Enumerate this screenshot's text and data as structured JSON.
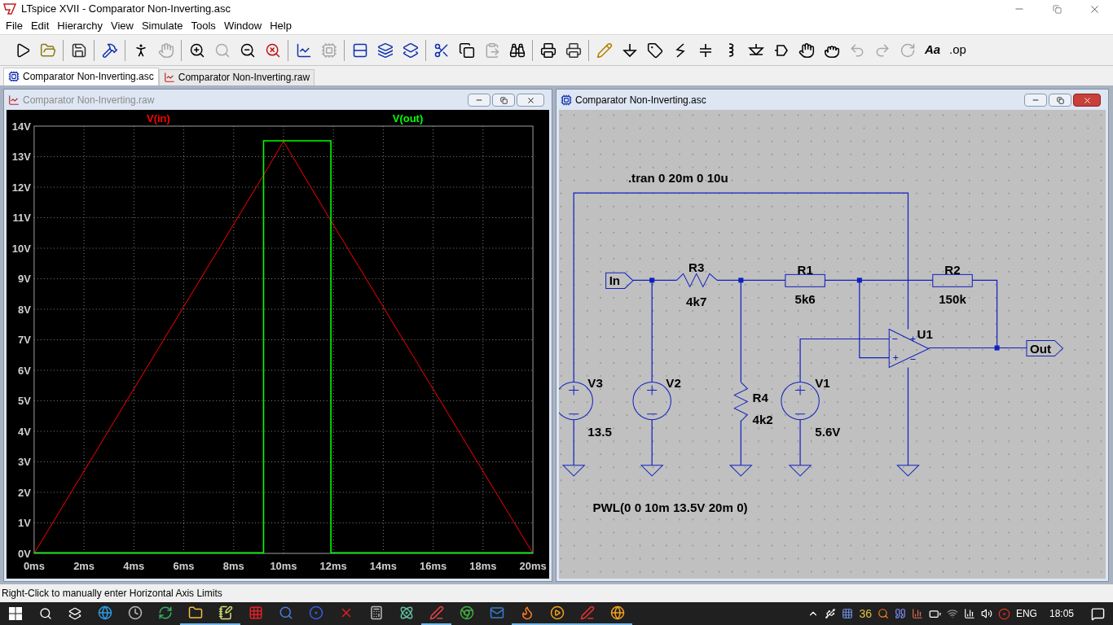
{
  "app": {
    "title": "LTspice XVII - Comparator Non-Inverting.asc"
  },
  "menu": [
    "File",
    "Edit",
    "Hierarchy",
    "View",
    "Simulate",
    "Tools",
    "Window",
    "Help"
  ],
  "toolbar": [
    {
      "disabled": false
    },
    {
      "disabled": false
    },
    {
      "disabled": false
    },
    {
      "disabled": false
    },
    {
      "disabled": false
    },
    {
      "disabled": true
    },
    {
      "disabled": false
    },
    {
      "disabled": true
    },
    {
      "disabled": false
    },
    {
      "disabled": false
    },
    {
      "disabled": false
    },
    {
      "disabled": true
    },
    {
      "disabled": false
    },
    {
      "disabled": false
    },
    {
      "disabled": false
    },
    {
      "disabled": false
    },
    {
      "disabled": false
    },
    {
      "disabled": true
    },
    {
      "disabled": false
    },
    {
      "disabled": false
    },
    {
      "disabled": false
    },
    {
      "disabled": false
    },
    {
      "disabled": false
    },
    {
      "disabled": false
    },
    {
      "disabled": false
    },
    {
      "disabled": false
    },
    {
      "disabled": false
    },
    {
      "disabled": false
    },
    {
      "disabled": false
    },
    {
      "disabled": false
    },
    {
      "disabled": false
    },
    {
      "disabled": true
    },
    {
      "disabled": true
    },
    {
      "disabled": true
    },
    {
      "disabled": false,
      "label": "Aa"
    },
    {
      "disabled": false,
      "label": ".op"
    }
  ],
  "tabs": [
    {
      "label": "Comparator Non-Inverting.asc",
      "kind": "schematic",
      "selected": true
    },
    {
      "label": "Comparator Non-Inverting.raw",
      "kind": "waveform",
      "selected": false
    }
  ],
  "waveform_window": {
    "title": "Comparator Non-Inverting.raw",
    "active": false,
    "chart_data": {
      "type": "line",
      "x": [
        0,
        9.2,
        9.2,
        10,
        11.9,
        11.9,
        20
      ],
      "series": [
        {
          "name": "V(in)",
          "color": "#ff0000",
          "values": [
            0,
            12.4,
            12.4,
            13.5,
            10.9,
            10.9,
            0
          ]
        },
        {
          "name": "V(out)",
          "color": "#00ff00",
          "values": [
            0,
            0,
            13.5,
            13.5,
            13.5,
            0,
            0
          ]
        }
      ],
      "xlim": [
        0,
        20
      ],
      "ylim": [
        0,
        14
      ],
      "grid": true,
      "xticks": [
        {
          "value": 0,
          "label": "0ms"
        },
        {
          "value": 2,
          "label": "2ms"
        },
        {
          "value": 4,
          "label": "4ms"
        },
        {
          "value": 6,
          "label": "6ms"
        },
        {
          "value": 8,
          "label": "8ms"
        },
        {
          "value": 10,
          "label": "10ms"
        },
        {
          "value": 12,
          "label": "12ms"
        },
        {
          "value": 14,
          "label": "14ms"
        },
        {
          "value": 16,
          "label": "16ms"
        },
        {
          "value": 18,
          "label": "18ms"
        },
        {
          "value": 20,
          "label": "20ms"
        }
      ],
      "yticks": [
        {
          "value": 0,
          "label": "0V"
        },
        {
          "value": 1,
          "label": "1V"
        },
        {
          "value": 2,
          "label": "2V"
        },
        {
          "value": 3,
          "label": "3V"
        },
        {
          "value": 4,
          "label": "4V"
        },
        {
          "value": 5,
          "label": "5V"
        },
        {
          "value": 6,
          "label": "6V"
        },
        {
          "value": 7,
          "label": "7V"
        },
        {
          "value": 8,
          "label": "8V"
        },
        {
          "value": 9,
          "label": "9V"
        },
        {
          "value": 10,
          "label": "10V"
        },
        {
          "value": 11,
          "label": "11V"
        },
        {
          "value": 12,
          "label": "12V"
        },
        {
          "value": 13,
          "label": "13V"
        },
        {
          "value": 14,
          "label": "14V"
        }
      ]
    }
  },
  "schematic_window": {
    "title": "Comparator Non-Inverting.asc",
    "active": true,
    "directives": [
      ".tran 0 20m 0 10u",
      "PWL(0 0 10m 13.5V 20m 0)"
    ],
    "net_labels": [
      "In",
      "Out"
    ],
    "components": [
      {
        "kind": "zigzag_resistor",
        "name": "R3",
        "value": "4k7"
      },
      {
        "kind": "box_resistor",
        "name": "R1",
        "value": "5k6"
      },
      {
        "kind": "box_resistor",
        "name": "R2",
        "value": "150k"
      },
      {
        "kind": "opamp",
        "name": "U1"
      },
      {
        "kind": "voltage_source",
        "name": "V3",
        "value": "13.5"
      },
      {
        "kind": "voltage_source",
        "name": "V2"
      },
      {
        "kind": "zigzag_resistor",
        "name": "R4",
        "value": "4k2"
      },
      {
        "kind": "voltage_source",
        "name": "V1",
        "value": "5.6V"
      }
    ]
  },
  "status_bar": "Right-Click to manually enter Horizontal Axis Limits",
  "taskbar": {
    "apps": [
      {
        "running": false
      },
      {
        "running": false
      },
      {
        "running": false
      },
      {
        "running": true
      },
      {
        "running": true
      },
      {
        "running": false
      },
      {
        "running": false
      },
      {
        "running": false
      },
      {
        "running": false
      },
      {
        "running": false
      },
      {
        "running": false
      },
      {
        "running": true
      },
      {
        "running": false
      },
      {
        "running": false
      },
      {
        "running": true
      },
      {
        "running": true
      },
      {
        "running": true
      },
      {
        "running": true
      }
    ],
    "badge": "36",
    "language": "ENG",
    "time": "18:05"
  }
}
